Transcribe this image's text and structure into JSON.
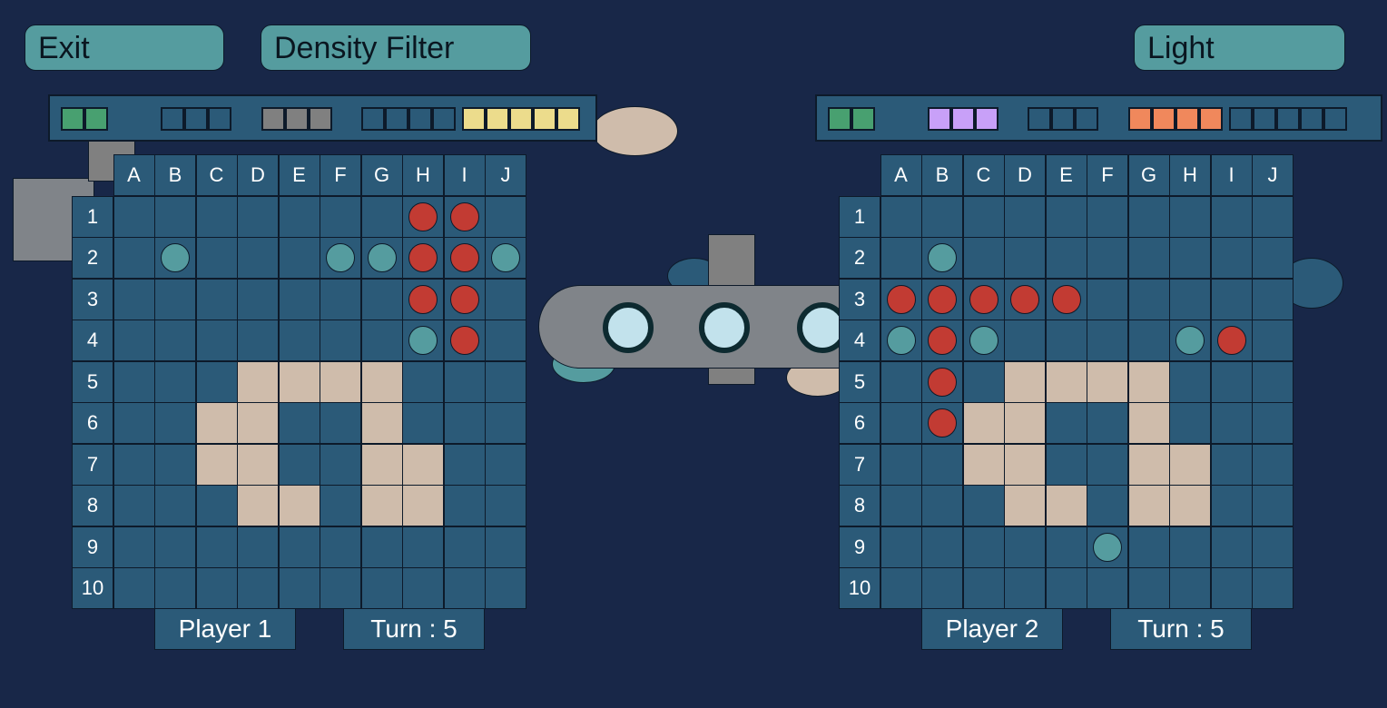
{
  "buttons": {
    "exit": "Exit",
    "density": "Density Filter",
    "light": "Light"
  },
  "columns": [
    "A",
    "B",
    "C",
    "D",
    "E",
    "F",
    "G",
    "H",
    "I",
    "J"
  ],
  "rows": [
    "1",
    "2",
    "3",
    "4",
    "5",
    "6",
    "7",
    "8",
    "9",
    "10"
  ],
  "colors": {
    "background": "#182748",
    "cell": "#2b5a78",
    "ship": "#cfbcab",
    "hit": "#c23b33",
    "miss": "#559c9f",
    "button": "#559c9f"
  },
  "players": [
    {
      "name": "Player 1",
      "turn": "Turn : 5",
      "fleet": [
        {
          "size": 2,
          "color": "#48a070"
        },
        {
          "size": 3,
          "color": null
        },
        {
          "size": 3,
          "color": "#808080"
        },
        {
          "size": 4,
          "color": null
        },
        {
          "size": 5,
          "color": "#ecdc8c"
        }
      ],
      "board": [
        ".......XX.",
        ".O...OOXXO",
        ".......XX.",
        ".......OX.",
        "...SSSS...",
        "..SS..S...",
        "..SS..SS..",
        "...SS.SS..",
        "..........",
        ".........."
      ]
    },
    {
      "name": "Player 2",
      "turn": "Turn : 5",
      "fleet": [
        {
          "size": 2,
          "color": "#48a070"
        },
        {
          "size": 3,
          "color": "#c8a0f8"
        },
        {
          "size": 3,
          "color": null
        },
        {
          "size": 4,
          "color": "#f0885c"
        },
        {
          "size": 5,
          "color": null
        }
      ],
      "board": [
        "..........",
        ".O........",
        "XXXXX.....",
        "OXO....OX.",
        ".X.SSSS...",
        ".XSS..S...",
        "..SS..SS..",
        "...SS.SS..",
        ".....O....",
        ".........."
      ]
    }
  ],
  "legend": {
    "X": "hit",
    "O": "miss",
    "S": "ship",
    ".": "empty"
  }
}
